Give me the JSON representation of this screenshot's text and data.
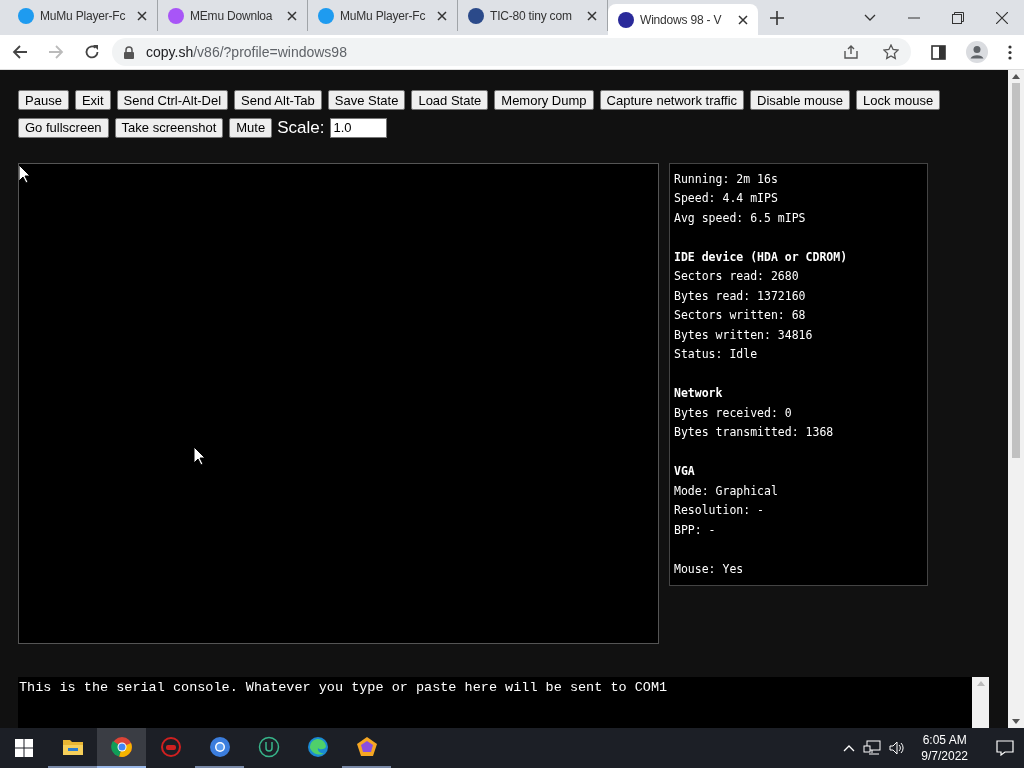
{
  "browser": {
    "tabs": [
      {
        "title": "MuMu Player-Fc",
        "selected": false,
        "color": "#1e9bf0"
      },
      {
        "title": "MEmu Downloa",
        "selected": false,
        "color": "#a855f7"
      },
      {
        "title": "MuMu Player-Fc",
        "selected": false,
        "color": "#1e9bf0"
      },
      {
        "title": "TIC-80 tiny com",
        "selected": false,
        "color": "#2b4a8a"
      },
      {
        "title": "Windows 98 - V",
        "selected": true,
        "color": "#2a2a9a"
      }
    ],
    "url_host": "copy.sh",
    "url_path": "/v86/?profile=windows98"
  },
  "toolbar": {
    "buttons": [
      "Pause",
      "Exit",
      "Send Ctrl-Alt-Del",
      "Send Alt-Tab",
      "Save State",
      "Load State",
      "Memory Dump",
      "Capture network traffic",
      "Disable mouse",
      "Lock mouse",
      "Go fullscreen",
      "Take screenshot",
      "Mute"
    ],
    "scale_label": "Scale:",
    "scale_value": "1.0"
  },
  "stats": [
    {
      "lines": [
        "Running: 2m 16s",
        "Speed: 4.4 mIPS",
        "Avg speed: 6.5 mIPS"
      ]
    },
    {
      "title": "IDE device (HDA or CDROM)",
      "lines": [
        "Sectors read: 2680",
        "Bytes read: 1372160",
        "Sectors written: 68",
        "Bytes written: 34816",
        "Status: Idle"
      ]
    },
    {
      "title": "Network",
      "lines": [
        "Bytes received: 0",
        "Bytes transmitted: 1368"
      ]
    },
    {
      "title": "VGA",
      "lines": [
        "Mode: Graphical",
        "Resolution: -",
        "BPP: -"
      ]
    },
    {
      "lines": [
        "Mouse: Yes"
      ]
    }
  ],
  "serial_console": {
    "value": "This is the serial console. Whatever you type or paste here will be sent to COM1"
  },
  "taskbar": {
    "time": "6:05 AM",
    "date": "9/7/2022"
  }
}
